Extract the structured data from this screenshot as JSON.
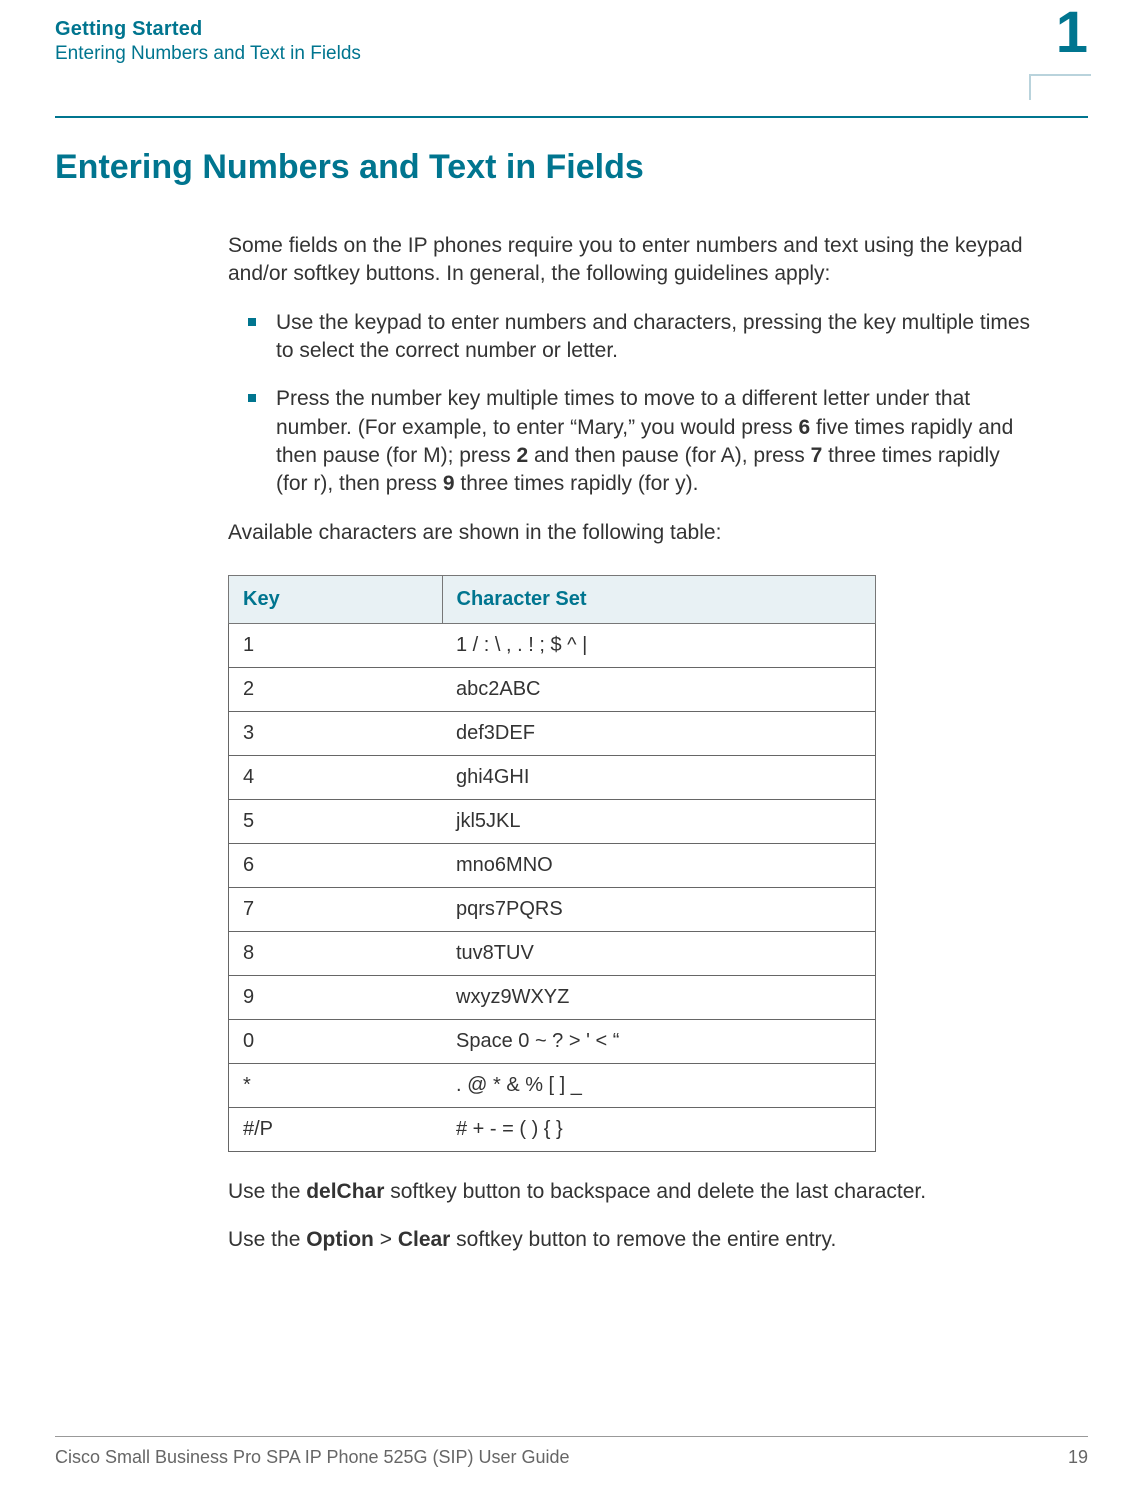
{
  "header": {
    "chapter_title": "Getting Started",
    "section_title": "Entering Numbers and Text in Fields",
    "chapter_number": "1"
  },
  "heading": "Entering Numbers and Text in Fields",
  "intro": "Some fields on the IP phones require you to enter numbers and text using the keypad and/or softkey buttons. In general, the following guidelines apply:",
  "bullets": [
    "Use the keypad to enter numbers and characters, pressing the key multiple times to select the correct number or letter.",
    {
      "pre": "Press the number key multiple times to move to a different letter under that number. (For example, to enter “Mary,” you would press ",
      "k1": "6",
      "mid1": " five times rapidly and then pause (for M); press ",
      "k2": "2",
      "mid2": " and then pause (for A), press ",
      "k3": "7",
      "mid3": " three times rapidly (for r), then press ",
      "k4": "9",
      "post": " three times rapidly (for y)."
    }
  ],
  "table_intro": "Available characters are shown in the following table:",
  "table": {
    "headers": [
      "Key",
      "Character Set"
    ],
    "rows": [
      [
        "1",
        "1 / : \\ , . ! ; $ ^ |"
      ],
      [
        "2",
        "abc2ABC"
      ],
      [
        "3",
        "def3DEF"
      ],
      [
        "4",
        "ghi4GHI"
      ],
      [
        "5",
        "jkl5JKL"
      ],
      [
        "6",
        "mno6MNO"
      ],
      [
        "7",
        "pqrs7PQRS"
      ],
      [
        "8",
        "tuv8TUV"
      ],
      [
        "9",
        "wxyz9WXYZ"
      ],
      [
        "0",
        "Space 0 ~ ? > ' < “"
      ],
      [
        "*",
        ". @ * & % [ ] _"
      ],
      [
        "#/P",
        "# + - = ( ) { }"
      ]
    ]
  },
  "after_table": [
    {
      "pre": "Use the ",
      "b1": "delChar",
      "post": " softkey button to backspace and delete the last character."
    },
    {
      "pre": "Use the ",
      "b1": "Option",
      "mid": " > ",
      "b2": "Clear",
      "post": " softkey button to remove the entire entry."
    }
  ],
  "footer": {
    "text": "Cisco Small Business Pro SPA IP Phone 525G (SIP) User Guide",
    "page": "19"
  }
}
